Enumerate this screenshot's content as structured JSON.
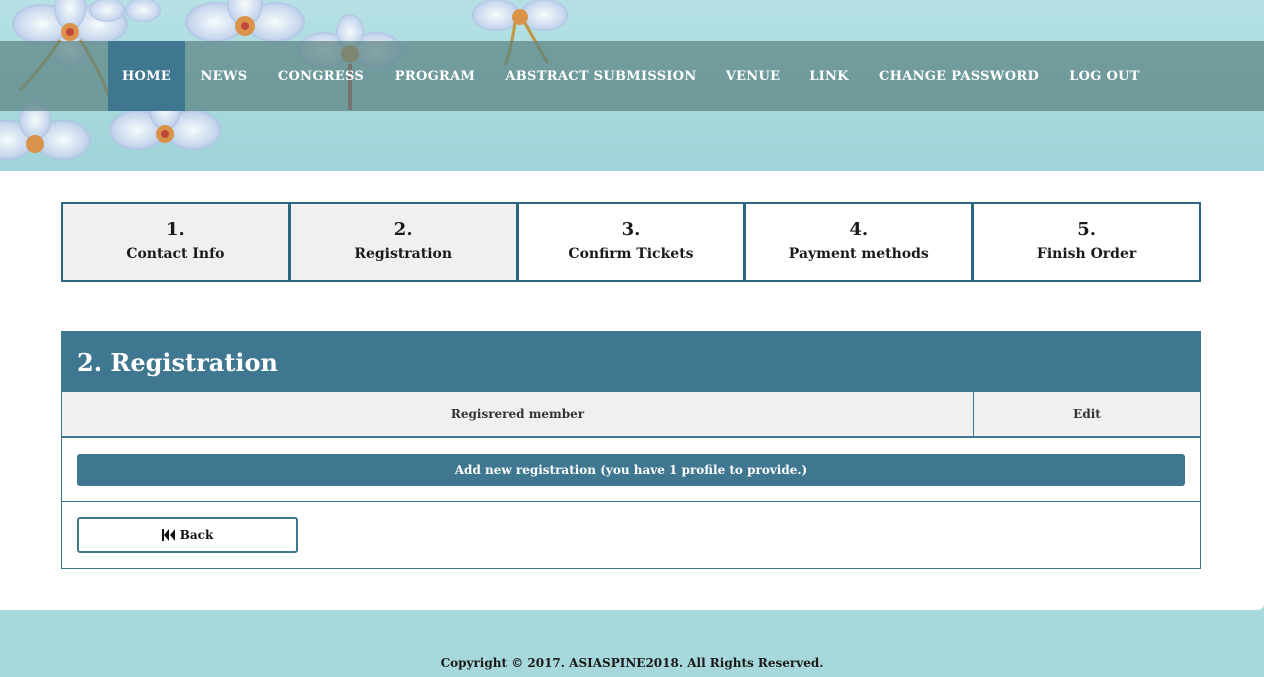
{
  "nav": {
    "items": [
      {
        "label": "HOME"
      },
      {
        "label": "NEWS"
      },
      {
        "label": "CONGRESS"
      },
      {
        "label": "PROGRAM"
      },
      {
        "label": "ABSTRACT SUBMISSION"
      },
      {
        "label": "VENUE"
      },
      {
        "label": "LINK"
      },
      {
        "label": "CHANGE PASSWORD"
      },
      {
        "label": "LOG OUT"
      }
    ],
    "active": "HOME"
  },
  "steps": [
    {
      "num": "1.",
      "label": "Contact Info",
      "state": "done"
    },
    {
      "num": "2.",
      "label": "Registration",
      "state": "current"
    },
    {
      "num": "3.",
      "label": "Confirm Tickets",
      "state": "pending"
    },
    {
      "num": "4.",
      "label": "Payment methods",
      "state": "pending"
    },
    {
      "num": "5.",
      "label": "Finish Order",
      "state": "pending"
    }
  ],
  "panel": {
    "title": "2. Registration",
    "columns": [
      "Regisrered member",
      "Edit"
    ],
    "add_button": "Add new registration (you have 1 profile to provide.)",
    "back_button": "Back"
  },
  "footer": {
    "copyright": "Copyright © 2017. ASIASPINE2018. All Rights Reserved."
  },
  "colors": {
    "accent": "#3f7791",
    "banner": "#a7d8dc",
    "step_done_bg": "#f0f0f0"
  },
  "icons": {
    "back": "fast-backward-icon",
    "decor": "orchid-illustration"
  }
}
